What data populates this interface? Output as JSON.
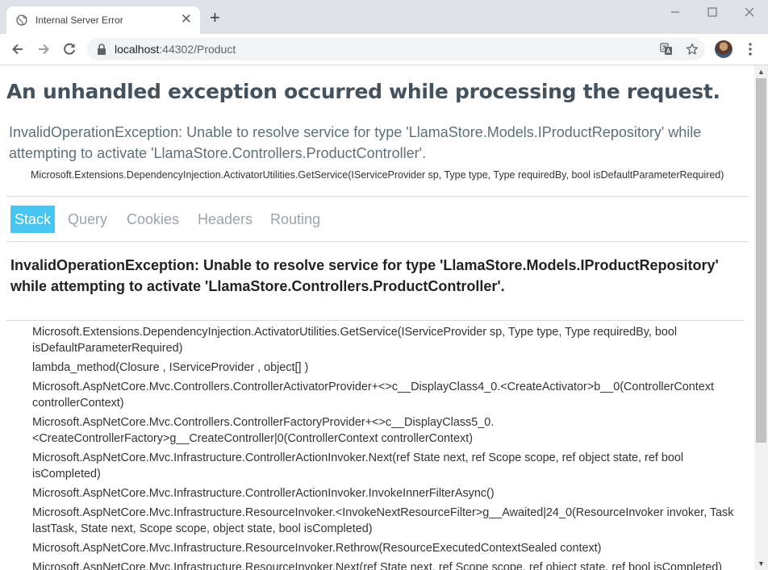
{
  "browser": {
    "tab_title": "Internal Server Error",
    "tab_close": "✕",
    "new_tab": "+",
    "url_host": "localhost",
    "url_rest": ":44302/Product",
    "window_controls": {
      "minimize": "—",
      "maximize": "☐",
      "close": "✕"
    }
  },
  "page": {
    "title": "An unhandled exception occurred while processing the request.",
    "error_message": "InvalidOperationException: Unable to resolve service for type 'LlamaStore.Models.IProductRepository' while attempting to activate 'LlamaStore.Controllers.ProductController'.",
    "error_location": "Microsoft.Extensions.DependencyInjection.ActivatorUtilities.GetService(IServiceProvider sp, Type type, Type requiredBy, bool isDefaultParameterRequired)",
    "tabs": [
      {
        "label": "Stack",
        "active": true
      },
      {
        "label": "Query",
        "active": false
      },
      {
        "label": "Cookies",
        "active": false
      },
      {
        "label": "Headers",
        "active": false
      },
      {
        "label": "Routing",
        "active": false
      }
    ],
    "stack_heading": "InvalidOperationException: Unable to resolve service for type 'LlamaStore.Models.IProductRepository' while attempting to activate 'LlamaStore.Controllers.ProductController'.",
    "frames": [
      "Microsoft.Extensions.DependencyInjection.ActivatorUtilities.GetService(IServiceProvider sp, Type type, Type requiredBy, bool isDefaultParameterRequired)",
      "lambda_method(Closure , IServiceProvider , object[] )",
      "Microsoft.AspNetCore.Mvc.Controllers.ControllerActivatorProvider+<>c__DisplayClass4_0.<CreateActivator>b__0(ControllerContext controllerContext)",
      "Microsoft.AspNetCore.Mvc.Controllers.ControllerFactoryProvider+<>c__DisplayClass5_0.<CreateControllerFactory>g__CreateController|0(ControllerContext controllerContext)",
      "Microsoft.AspNetCore.Mvc.Infrastructure.ControllerActionInvoker.Next(ref State next, ref Scope scope, ref object state, ref bool isCompleted)",
      "Microsoft.AspNetCore.Mvc.Infrastructure.ControllerActionInvoker.InvokeInnerFilterAsync()",
      "Microsoft.AspNetCore.Mvc.Infrastructure.ResourceInvoker.<InvokeNextResourceFilter>g__Awaited|24_0(ResourceInvoker invoker, Task lastTask, State next, Scope scope, object state, bool isCompleted)",
      "Microsoft.AspNetCore.Mvc.Infrastructure.ResourceInvoker.Rethrow(ResourceExecutedContextSealed context)",
      "Microsoft.AspNetCore.Mvc.Infrastructure.ResourceInvoker.Next(ref State next, ref Scope scope, ref object state, ref bool isCompleted)"
    ]
  },
  "colors": {
    "active_tab": "#44c5f2",
    "title": "#44525e",
    "chrome": "#dee1e6"
  },
  "icons": [
    "globe-icon",
    "close-icon",
    "plus-icon",
    "minimize-icon",
    "maximize-icon",
    "window-close-icon",
    "back-icon",
    "forward-icon",
    "reload-icon",
    "lock-icon",
    "translate-icon",
    "star-icon",
    "avatar",
    "menu-icon"
  ]
}
